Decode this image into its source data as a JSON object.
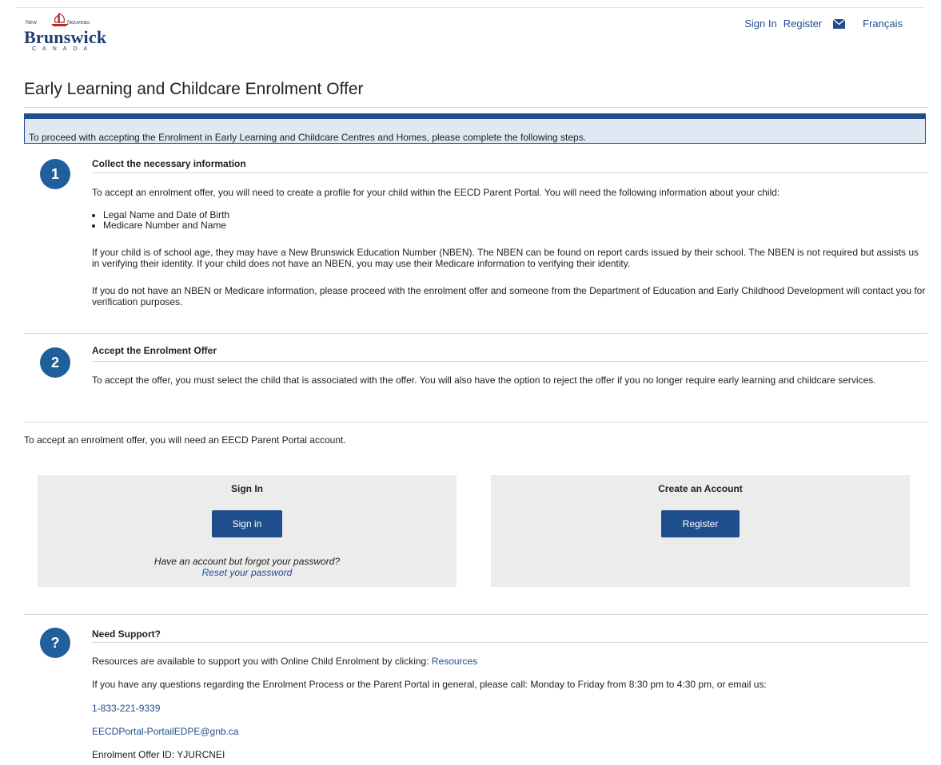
{
  "header": {
    "logo": {
      "top_left": "New",
      "top_right": "Nouveau",
      "brand": "Brunswick",
      "country": "CANADA"
    },
    "nav": {
      "sign_in": "Sign In",
      "register": "Register",
      "mail_icon": "envelope-icon",
      "language": "Français"
    }
  },
  "page_title": "Early Learning and Childcare Enrolment Offer",
  "banner_text": "To proceed with accepting the Enrolment in Early Learning and Childcare Centres and Homes, please complete the following steps.",
  "steps": [
    {
      "number": "1",
      "heading": "Collect the necessary information",
      "intro": "To accept an enrolment offer, you will need to create a profile for your child within the EECD Parent Portal. You will need the following information about your child:",
      "bullets": [
        "Legal Name and Date of Birth",
        "Medicare Number and Name"
      ],
      "para2": "If your child is of school age, they may have a New Brunswick Education Number (NBEN). The NBEN can be found on report cards issued by their school. The NBEN is not required but assists us in verifying their identity. If your child does not have an NBEN, you may use their Medicare information to verifying their identity.",
      "para3": "If you do not have an NBEN or Medicare information, please proceed with the enrolment offer and someone from the Department of Education and Early Childhood Development will contact you for verification purposes."
    },
    {
      "number": "2",
      "heading": "Accept the Enrolment Offer",
      "intro": "To accept the offer, you must select the child that is associated with the offer. You will also have the option to reject the offer if you no longer require early learning and childcare services."
    }
  ],
  "account_note": "To accept an enrolment offer, you will need an EECD Parent Portal account.",
  "sign_in_panel": {
    "title": "Sign In",
    "button": "Sign in",
    "forgot_text": "Have an account but forgot your password?",
    "reset_link": "Reset your password"
  },
  "register_panel": {
    "title": "Create an Account",
    "button": "Register"
  },
  "support": {
    "icon": "?",
    "heading": "Need Support?",
    "resources_text": "Resources are available to support you with Online Child Enrolment by clicking: ",
    "resources_link": "Resources",
    "questions_text": "If you have any questions regarding the Enrolment Process or the Parent Portal in general, please call: Monday to Friday from 8:30 pm to 4:30 pm, or email us:",
    "phone": "1-833-221-9339",
    "email": "EECDPortal-PortailEDPE@gnb.ca",
    "offer_id": "Enrolment Offer ID: YJURCNEI"
  },
  "colors": {
    "primary": "#1f4e8c",
    "banner_bg": "#dfe8f3",
    "panel_bg": "#ececec",
    "step_circle": "#1f5f9b"
  }
}
